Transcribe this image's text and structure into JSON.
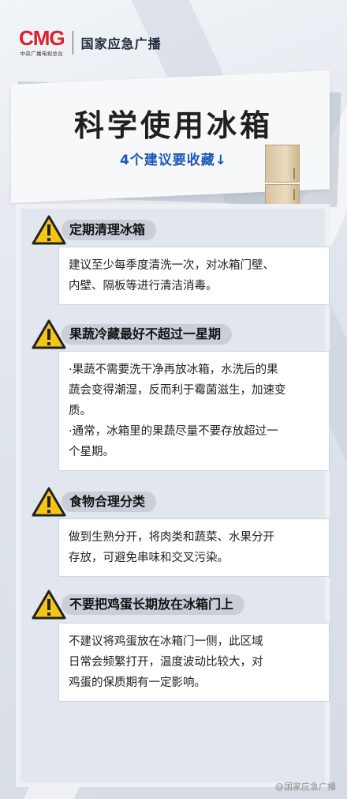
{
  "header": {
    "logo": "CMG",
    "logo_sub": "中央广播电视总台",
    "title": "国家应急广播"
  },
  "title": "科学使用冰箱",
  "subtitle": "4个建议要收藏↓",
  "sections": [
    {
      "heading": "定期清理冰箱",
      "body": [
        "建议至少每季度清洗一次，对冰箱门壁、",
        "内壁、隔板等进行清洁消毒。"
      ]
    },
    {
      "heading": "果蔬冷藏最好不超过一星期",
      "body": [
        "·果蔬不需要洗干净再放冰箱，水洗后的果",
        "蔬会变得潮湿，反而利于霉菌滋生，加速变",
        "质。",
        "·通常，冰箱里的果蔬尽量不要存放超过一",
        "个星期。"
      ]
    },
    {
      "heading": "食物合理分类",
      "body": [
        "做到生熟分开，将肉类和蔬菜、水果分开",
        "存放，可避免串味和交叉污染。"
      ]
    },
    {
      "heading": "不要把鸡蛋长期放在冰箱门上",
      "body": [
        "不建议将鸡蛋放在冰箱门一侧，此区域",
        "日常会频繁打开，温度波动比较大，对",
        "鸡蛋的保质期有一定影响。"
      ]
    }
  ],
  "watermark": "@国家应急广播",
  "icons": {
    "warning": "warning-triangle-icon",
    "fridge": "refrigerator-icon"
  },
  "colors": {
    "brand_red": "#d9232a",
    "subtitle_blue": "#1d57b8",
    "warning_yellow": "#f5c518"
  }
}
